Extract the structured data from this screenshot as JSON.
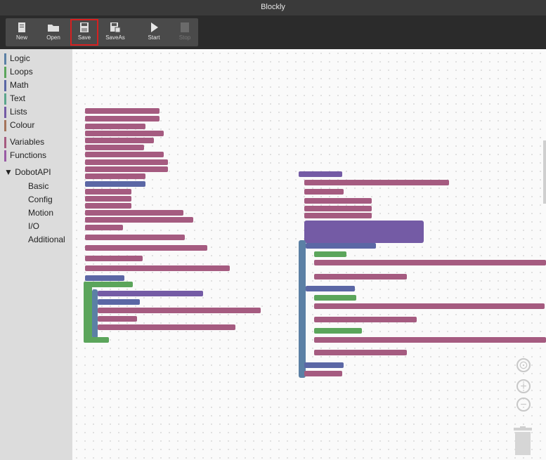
{
  "window": {
    "title": "Blockly"
  },
  "toolbar": {
    "buttons": [
      {
        "label": "New",
        "icon": "new-file-icon",
        "state": "normal"
      },
      {
        "label": "Open",
        "icon": "folder-open-icon",
        "state": "normal"
      },
      {
        "label": "Save",
        "icon": "save-icon",
        "state": "highlighted"
      },
      {
        "label": "SaveAs",
        "icon": "save-as-icon",
        "state": "normal"
      },
      {
        "label": "Start",
        "icon": "play-icon",
        "state": "normal"
      },
      {
        "label": "Stop",
        "icon": "stop-icon",
        "state": "disabled"
      }
    ]
  },
  "sidebar": {
    "categories": [
      {
        "label": "Logic",
        "color": "#5b80a5"
      },
      {
        "label": "Loops",
        "color": "#5ba55b"
      },
      {
        "label": "Math",
        "color": "#5b67a5"
      },
      {
        "label": "Text",
        "color": "#5ba58c"
      },
      {
        "label": "Lists",
        "color": "#745ba5"
      },
      {
        "label": "Colour",
        "color": "#a5745b"
      },
      {
        "label": "Variables",
        "color": "#a55b80"
      },
      {
        "label": "Functions",
        "color": "#995ba5"
      }
    ],
    "api_group": {
      "label": "▼ DobotAPI",
      "color": "#a55b5b"
    },
    "api_subcategories": [
      "Basic",
      "Config",
      "Motion",
      "I/O",
      "Additional"
    ]
  },
  "workspace": {
    "controls": [
      "recenter-icon",
      "zoom-in-icon",
      "zoom-out-icon",
      "trash-icon"
    ],
    "zoom_in_label": "+",
    "zoom_out_label": "−"
  },
  "colors": {
    "toolbar_bg": "#2b2b2b",
    "sidebar_bg": "#dcdcdc",
    "variables_block": "#a55b80",
    "math_block": "#5b67a5",
    "lists_block": "#745ba5",
    "loops_block": "#5ba55b",
    "highlight": "#d62020"
  }
}
